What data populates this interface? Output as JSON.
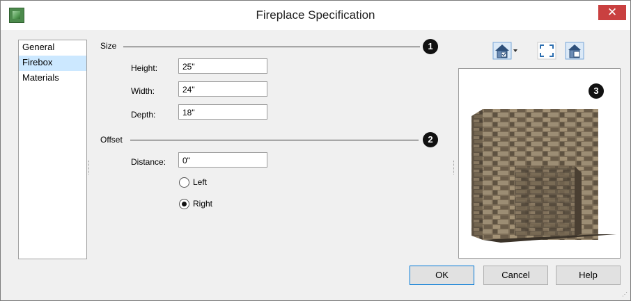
{
  "window": {
    "title": "Fireplace Specification",
    "close_glyph": "✕"
  },
  "sidebar": {
    "items": [
      {
        "label": "General"
      },
      {
        "label": "Firebox"
      },
      {
        "label": "Materials"
      }
    ],
    "selected": "Firebox"
  },
  "size_section": {
    "label": "Size",
    "callout": "1",
    "fields": [
      {
        "label": "Height:",
        "value": "25\""
      },
      {
        "label": "Width:",
        "value": "24\""
      },
      {
        "label": "Depth:",
        "value": "18\""
      }
    ]
  },
  "offset_section": {
    "label": "Offset",
    "callout": "2",
    "distance_label": "Distance:",
    "distance_value": "0\"",
    "radios": [
      {
        "label": "Left",
        "checked": false
      },
      {
        "label": "Right",
        "checked": true
      }
    ]
  },
  "preview": {
    "callout": "3",
    "toolbar_icons": [
      "view-mode-icon",
      "dropdown-arrow-icon",
      "fit-view-icon",
      "camera-view-icon"
    ]
  },
  "buttons": {
    "ok": "OK",
    "cancel": "Cancel",
    "help": "Help"
  },
  "colors": {
    "close_button": "#c94040",
    "selection": "#cce8ff",
    "default_button_border": "#0078d7",
    "stone": "#8a7a62"
  }
}
